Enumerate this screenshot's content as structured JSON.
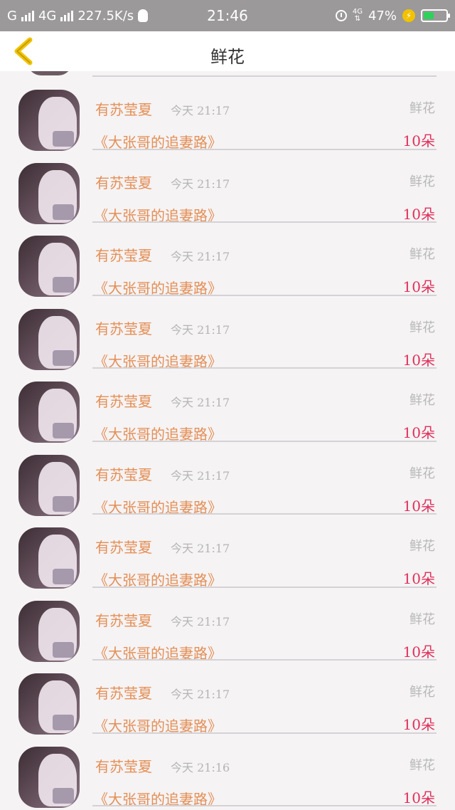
{
  "status_bar": {
    "carrier": "G",
    "network": "4G",
    "speed": "227.5K/s",
    "time": "21:46",
    "net_small": "4G",
    "battery_percent": "47%",
    "battery_level": 0.47
  },
  "header": {
    "title": "鲜花"
  },
  "rows": [
    {
      "user": "有苏莹夏",
      "date": "今天",
      "time": "21:17",
      "gift": "鲜花",
      "book": "《大张哥的追妻路》",
      "amount": "10朵"
    },
    {
      "user": "有苏莹夏",
      "date": "今天",
      "time": "21:17",
      "gift": "鲜花",
      "book": "《大张哥的追妻路》",
      "amount": "10朵"
    },
    {
      "user": "有苏莹夏",
      "date": "今天",
      "time": "21:17",
      "gift": "鲜花",
      "book": "《大张哥的追妻路》",
      "amount": "10朵"
    },
    {
      "user": "有苏莹夏",
      "date": "今天",
      "time": "21:17",
      "gift": "鲜花",
      "book": "《大张哥的追妻路》",
      "amount": "10朵"
    },
    {
      "user": "有苏莹夏",
      "date": "今天",
      "time": "21:17",
      "gift": "鲜花",
      "book": "《大张哥的追妻路》",
      "amount": "10朵"
    },
    {
      "user": "有苏莹夏",
      "date": "今天",
      "time": "21:17",
      "gift": "鲜花",
      "book": "《大张哥的追妻路》",
      "amount": "10朵"
    },
    {
      "user": "有苏莹夏",
      "date": "今天",
      "time": "21:17",
      "gift": "鲜花",
      "book": "《大张哥的追妻路》",
      "amount": "10朵"
    },
    {
      "user": "有苏莹夏",
      "date": "今天",
      "time": "21:17",
      "gift": "鲜花",
      "book": "《大张哥的追妻路》",
      "amount": "10朵"
    },
    {
      "user": "有苏莹夏",
      "date": "今天",
      "time": "21:17",
      "gift": "鲜花",
      "book": "《大张哥的追妻路》",
      "amount": "10朵"
    },
    {
      "user": "有苏莹夏",
      "date": "今天",
      "time": "21:16",
      "gift": "鲜花",
      "book": "《大张哥的追妻路》",
      "amount": "10朵"
    }
  ],
  "colors": {
    "accent_name": "#e48f56",
    "amount": "#e0305a",
    "back_arrow": "#f2c200",
    "status_bar_bg": "#9b999a"
  }
}
